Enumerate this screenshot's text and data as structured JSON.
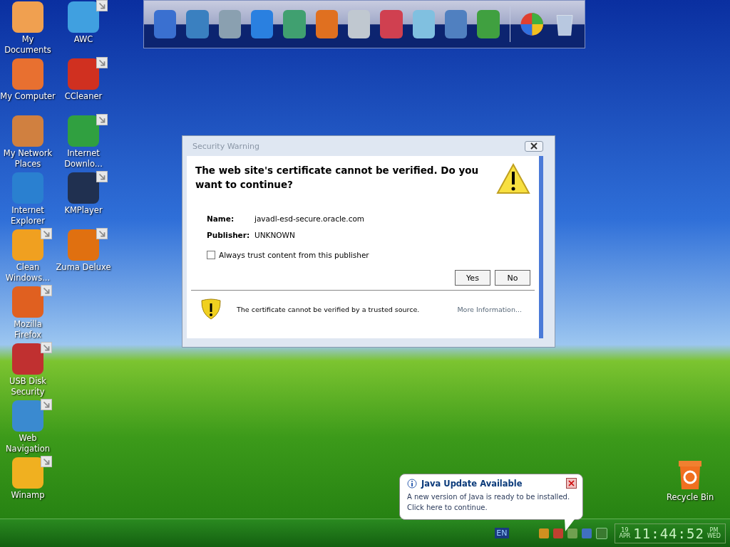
{
  "desktop_icons": [
    {
      "label": "My Documents",
      "shortcut": false
    },
    {
      "label": "My Computer",
      "shortcut": false
    },
    {
      "label": "My Network Places",
      "shortcut": false
    },
    {
      "label": "Internet Explorer",
      "shortcut": false
    },
    {
      "label": "Clean Windows...",
      "shortcut": true
    },
    {
      "label": "Mozilla Firefox",
      "shortcut": true
    },
    {
      "label": "USB Disk Security",
      "shortcut": true
    },
    {
      "label": "Web Navigation",
      "shortcut": true
    },
    {
      "label": "Winamp",
      "shortcut": true
    },
    {
      "label": "AWC",
      "shortcut": true
    },
    {
      "label": "CCleaner",
      "shortcut": true
    },
    {
      "label": "Internet Downlo...",
      "shortcut": true
    },
    {
      "label": "KMPlayer",
      "shortcut": true
    },
    {
      "label": "Zuma Deluxe",
      "shortcut": true
    }
  ],
  "recycle_bin": {
    "label": "Recycle Bin"
  },
  "dialog": {
    "title": "Security Warning",
    "heading": "The web site's certificate cannot be verified. Do you want to continue?",
    "fields": [
      {
        "label": "Name:",
        "value": "javadl-esd-secure.oracle.com"
      },
      {
        "label": "Publisher:",
        "value": "UNKNOWN"
      }
    ],
    "checkbox": {
      "label": "Always trust content from this publisher",
      "checked": false
    },
    "buttons": [
      "Yes",
      "No"
    ],
    "footer_text": "The certificate cannot be verified by a trusted source.",
    "more_link": "More Information..."
  },
  "balloon": {
    "title": "Java Update Available",
    "message": "A new version of Java is ready to be installed. Click here to continue."
  },
  "taskbar": {
    "language": "EN",
    "date_day": "19",
    "date_month": "APR",
    "time": "11:44:52",
    "ampm": "PM",
    "weekday": "WED"
  }
}
